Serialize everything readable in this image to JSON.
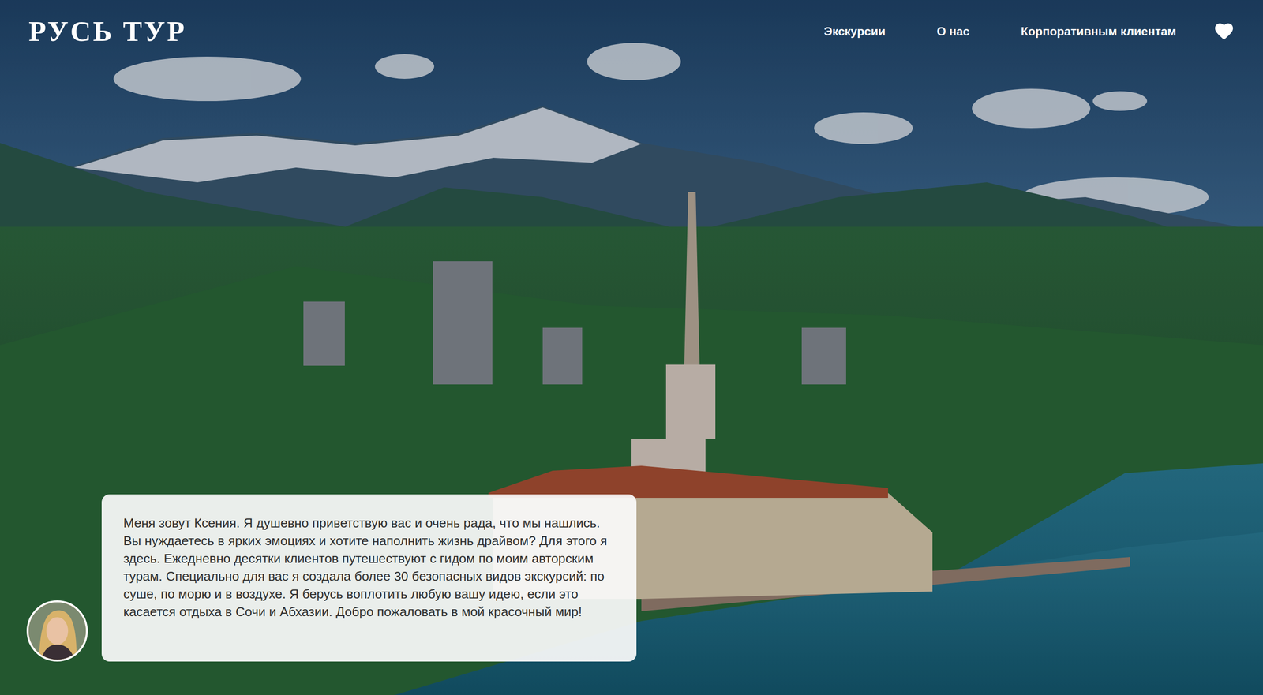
{
  "header": {
    "logo": "РУСЬ ТУР",
    "nav": [
      {
        "label": "Экскурсии"
      },
      {
        "label": "О нас"
      },
      {
        "label": "Корпоративным клиентам"
      }
    ]
  },
  "intro": {
    "text": "Меня зовут Ксения. Я душевно приветствую вас и очень рада, что мы нашлись. Вы нуждаетесь в ярких эмоциях и хотите наполнить жизнь драйвом? Для этого я здесь. Ежедневно десятки клиентов путешествуют с гидом по моим авторским турам. Специально для вас я создала более 30 безопасных видов экскурсий: по суше, по морю и в воздухе. Я берусь воплотить любую вашу идею, если это касается отдыха в Сочи и Абхазии. Добро пожаловать в мой красочный мир!"
  }
}
